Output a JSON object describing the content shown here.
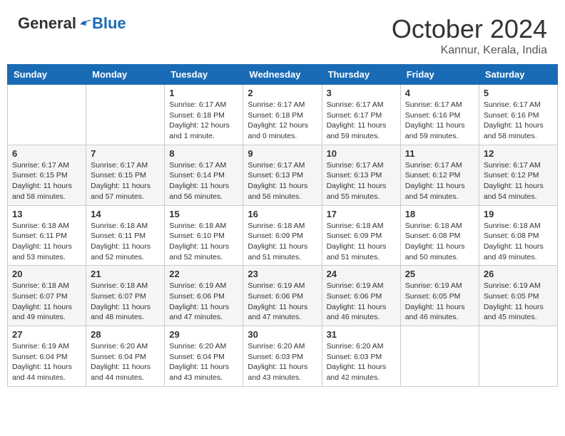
{
  "header": {
    "logo_general": "General",
    "logo_blue": "Blue",
    "month_title": "October 2024",
    "subtitle": "Kannur, Kerala, India"
  },
  "days_of_week": [
    "Sunday",
    "Monday",
    "Tuesday",
    "Wednesday",
    "Thursday",
    "Friday",
    "Saturday"
  ],
  "weeks": [
    [
      {
        "day": "",
        "info": ""
      },
      {
        "day": "",
        "info": ""
      },
      {
        "day": "1",
        "info": "Sunrise: 6:17 AM\nSunset: 6:18 PM\nDaylight: 12 hours\nand 1 minute."
      },
      {
        "day": "2",
        "info": "Sunrise: 6:17 AM\nSunset: 6:18 PM\nDaylight: 12 hours\nand 0 minutes."
      },
      {
        "day": "3",
        "info": "Sunrise: 6:17 AM\nSunset: 6:17 PM\nDaylight: 11 hours\nand 59 minutes."
      },
      {
        "day": "4",
        "info": "Sunrise: 6:17 AM\nSunset: 6:16 PM\nDaylight: 11 hours\nand 59 minutes."
      },
      {
        "day": "5",
        "info": "Sunrise: 6:17 AM\nSunset: 6:16 PM\nDaylight: 11 hours\nand 58 minutes."
      }
    ],
    [
      {
        "day": "6",
        "info": "Sunrise: 6:17 AM\nSunset: 6:15 PM\nDaylight: 11 hours\nand 58 minutes."
      },
      {
        "day": "7",
        "info": "Sunrise: 6:17 AM\nSunset: 6:15 PM\nDaylight: 11 hours\nand 57 minutes."
      },
      {
        "day": "8",
        "info": "Sunrise: 6:17 AM\nSunset: 6:14 PM\nDaylight: 11 hours\nand 56 minutes."
      },
      {
        "day": "9",
        "info": "Sunrise: 6:17 AM\nSunset: 6:13 PM\nDaylight: 11 hours\nand 56 minutes."
      },
      {
        "day": "10",
        "info": "Sunrise: 6:17 AM\nSunset: 6:13 PM\nDaylight: 11 hours\nand 55 minutes."
      },
      {
        "day": "11",
        "info": "Sunrise: 6:17 AM\nSunset: 6:12 PM\nDaylight: 11 hours\nand 54 minutes."
      },
      {
        "day": "12",
        "info": "Sunrise: 6:17 AM\nSunset: 6:12 PM\nDaylight: 11 hours\nand 54 minutes."
      }
    ],
    [
      {
        "day": "13",
        "info": "Sunrise: 6:18 AM\nSunset: 6:11 PM\nDaylight: 11 hours\nand 53 minutes."
      },
      {
        "day": "14",
        "info": "Sunrise: 6:18 AM\nSunset: 6:11 PM\nDaylight: 11 hours\nand 52 minutes."
      },
      {
        "day": "15",
        "info": "Sunrise: 6:18 AM\nSunset: 6:10 PM\nDaylight: 11 hours\nand 52 minutes."
      },
      {
        "day": "16",
        "info": "Sunrise: 6:18 AM\nSunset: 6:09 PM\nDaylight: 11 hours\nand 51 minutes."
      },
      {
        "day": "17",
        "info": "Sunrise: 6:18 AM\nSunset: 6:09 PM\nDaylight: 11 hours\nand 51 minutes."
      },
      {
        "day": "18",
        "info": "Sunrise: 6:18 AM\nSunset: 6:08 PM\nDaylight: 11 hours\nand 50 minutes."
      },
      {
        "day": "19",
        "info": "Sunrise: 6:18 AM\nSunset: 6:08 PM\nDaylight: 11 hours\nand 49 minutes."
      }
    ],
    [
      {
        "day": "20",
        "info": "Sunrise: 6:18 AM\nSunset: 6:07 PM\nDaylight: 11 hours\nand 49 minutes."
      },
      {
        "day": "21",
        "info": "Sunrise: 6:18 AM\nSunset: 6:07 PM\nDaylight: 11 hours\nand 48 minutes."
      },
      {
        "day": "22",
        "info": "Sunrise: 6:19 AM\nSunset: 6:06 PM\nDaylight: 11 hours\nand 47 minutes."
      },
      {
        "day": "23",
        "info": "Sunrise: 6:19 AM\nSunset: 6:06 PM\nDaylight: 11 hours\nand 47 minutes."
      },
      {
        "day": "24",
        "info": "Sunrise: 6:19 AM\nSunset: 6:06 PM\nDaylight: 11 hours\nand 46 minutes."
      },
      {
        "day": "25",
        "info": "Sunrise: 6:19 AM\nSunset: 6:05 PM\nDaylight: 11 hours\nand 46 minutes."
      },
      {
        "day": "26",
        "info": "Sunrise: 6:19 AM\nSunset: 6:05 PM\nDaylight: 11 hours\nand 45 minutes."
      }
    ],
    [
      {
        "day": "27",
        "info": "Sunrise: 6:19 AM\nSunset: 6:04 PM\nDaylight: 11 hours\nand 44 minutes."
      },
      {
        "day": "28",
        "info": "Sunrise: 6:20 AM\nSunset: 6:04 PM\nDaylight: 11 hours\nand 44 minutes."
      },
      {
        "day": "29",
        "info": "Sunrise: 6:20 AM\nSunset: 6:04 PM\nDaylight: 11 hours\nand 43 minutes."
      },
      {
        "day": "30",
        "info": "Sunrise: 6:20 AM\nSunset: 6:03 PM\nDaylight: 11 hours\nand 43 minutes."
      },
      {
        "day": "31",
        "info": "Sunrise: 6:20 AM\nSunset: 6:03 PM\nDaylight: 11 hours\nand 42 minutes."
      },
      {
        "day": "",
        "info": ""
      },
      {
        "day": "",
        "info": ""
      }
    ]
  ]
}
